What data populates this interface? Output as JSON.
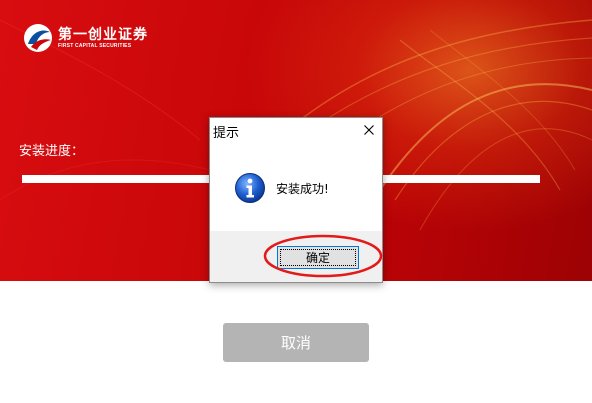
{
  "logo": {
    "name_cn": "第一创业证券",
    "name_en": "FIRST CAPITAL SECURITIES"
  },
  "installer": {
    "progress_label": "安装进度：",
    "progress_fraction": 1.0,
    "cancel_label": "取消"
  },
  "dialog": {
    "title": "提示",
    "message": "安装成功!",
    "ok_label": "确定",
    "icon": "info-icon",
    "close_icon": "close-icon"
  },
  "colors": {
    "banner_red": "#c90709",
    "dialog_accent": "#0078d7",
    "annotation_red": "#e21a1a",
    "cancel_gray": "#b4b4b4"
  }
}
